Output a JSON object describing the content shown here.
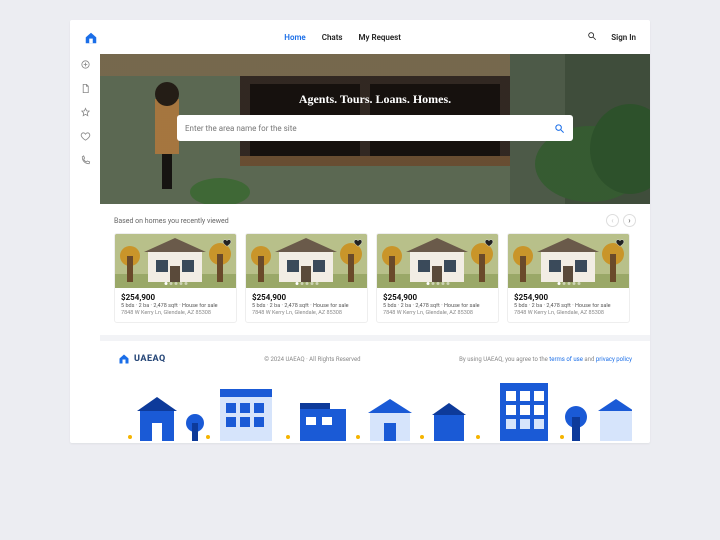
{
  "nav": {
    "home": "Home",
    "chats": "Chats",
    "myrequest": "My Request"
  },
  "auth": {
    "signin": "Sign In"
  },
  "hero": {
    "title": "Agents. Tours. Loans. Homes.",
    "placeholder": "Enter the area name for the site"
  },
  "section": {
    "title": "Based on homes you recently viewed"
  },
  "listings": [
    {
      "price": "$254,900",
      "meta": "5 bds · 2 ba · 2,478 sqft · House for sale",
      "addr": "7848 W Kerry Ln, Glendale, AZ 85308"
    },
    {
      "price": "$254,900",
      "meta": "5 bds · 2 ba · 2,478 sqft · House for sale",
      "addr": "7848 W Kerry Ln, Glendale, AZ 85308"
    },
    {
      "price": "$254,900",
      "meta": "5 bds · 2 ba · 2,478 sqft · House for sale",
      "addr": "7848 W Kerry Ln, Glendale, AZ 85308"
    },
    {
      "price": "$254,900",
      "meta": "5 bds · 2 ba · 2,478 sqft · House for sale",
      "addr": "7848 W Kerry Ln, Glendale, AZ 85308"
    }
  ],
  "footer": {
    "brand": "UAEAQ",
    "copyright": "© 2024 UAEAQ  ·  All Rights Reserved",
    "agree_pre": "By using UAEAQ, you agree to the ",
    "terms": "terms of use",
    "and": " and ",
    "privacy": "privacy policy"
  }
}
